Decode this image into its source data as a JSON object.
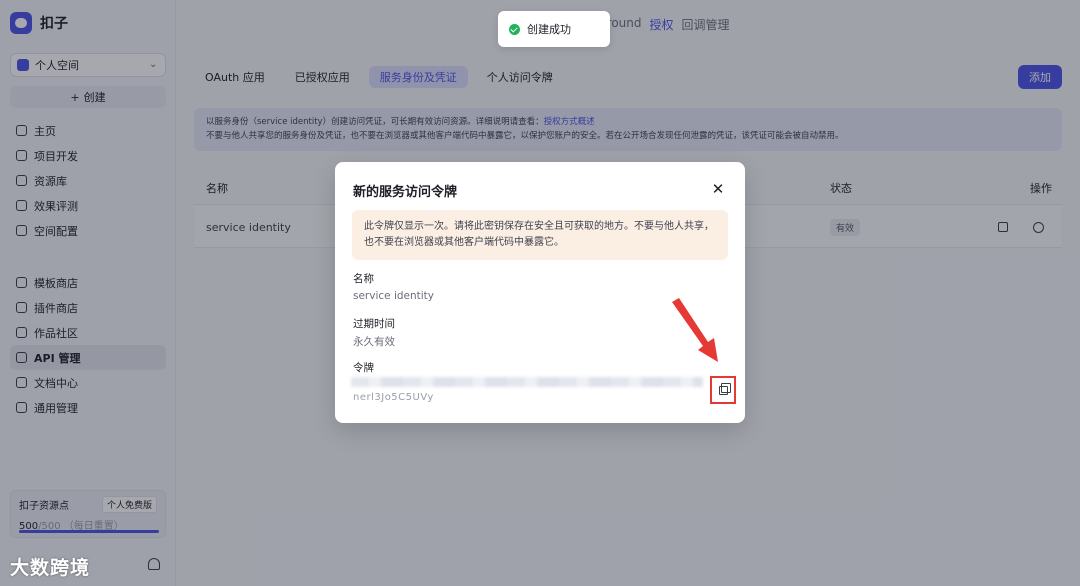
{
  "app": {
    "name": "扣子"
  },
  "sidebar": {
    "space": "个人空间",
    "create_label": "创建",
    "create_icon": "plus-icon",
    "group1": [
      {
        "label": "主页",
        "icon": "home-icon"
      },
      {
        "label": "项目开发",
        "icon": "project-icon"
      },
      {
        "label": "资源库",
        "icon": "library-icon"
      },
      {
        "label": "效果评测",
        "icon": "evaluation-icon"
      },
      {
        "label": "空间配置",
        "icon": "space-config-icon"
      }
    ],
    "group2": [
      {
        "label": "模板商店",
        "icon": "template-icon"
      },
      {
        "label": "插件商店",
        "icon": "plugin-icon"
      },
      {
        "label": "作品社区",
        "icon": "community-icon"
      },
      {
        "label": "API 管理",
        "icon": "api-icon",
        "active": true
      },
      {
        "label": "文档中心",
        "icon": "docs-icon"
      },
      {
        "label": "通用管理",
        "icon": "general-icon"
      }
    ],
    "points": {
      "title": "扣子资源点",
      "plan": "个人免费版",
      "value": "500",
      "total": "/500",
      "note": "（每日重置）",
      "fill_fraction": 1.0
    },
    "watermark": "大数跨境"
  },
  "top_links": [
    {
      "label": "Playground",
      "active": false
    },
    {
      "label": "授权",
      "active": true
    },
    {
      "label": "回调管理",
      "active": false
    }
  ],
  "tabs": [
    {
      "label": "OAuth 应用",
      "active": false
    },
    {
      "label": "已授权应用",
      "active": false
    },
    {
      "label": "服务身份及凭证",
      "active": true
    },
    {
      "label": "个人访问令牌",
      "active": false
    }
  ],
  "add_button": "添加",
  "info": {
    "line1": "以服务身份（service identity）创建访问凭证，可长期有效访问资源。详细说明请查看：",
    "link": "授权方式概述",
    "line2": "不要与他人共享您的服务身份及凭证，也不要在浏览器或其他客户端代码中暴露它，以保护您账户的安全。若在公开场合发现任何泄露的凭证，该凭证可能会被自动禁用。"
  },
  "table": {
    "headers": {
      "name": "名称",
      "status": "状态",
      "actions": "操作"
    },
    "rows": [
      {
        "name": "service identity",
        "status": "有效"
      }
    ]
  },
  "toast": {
    "message": "创建成功",
    "color": "#21b35a"
  },
  "modal": {
    "title": "新的服务访问令牌",
    "warning": "此令牌仅显示一次。请将此密钥保存在安全且可获取的地方。不要与他人共享，也不要在浏览器或其他客户端代码中暴露它。",
    "name_label": "名称",
    "name_value": "service identity",
    "expire_label": "过期时间",
    "expire_value": "永久有效",
    "token_label": "令牌",
    "token_tail": "nerl3Jo5C5UVy"
  },
  "colors": {
    "accent": "#4d53e8",
    "annotation": "#e53935"
  }
}
